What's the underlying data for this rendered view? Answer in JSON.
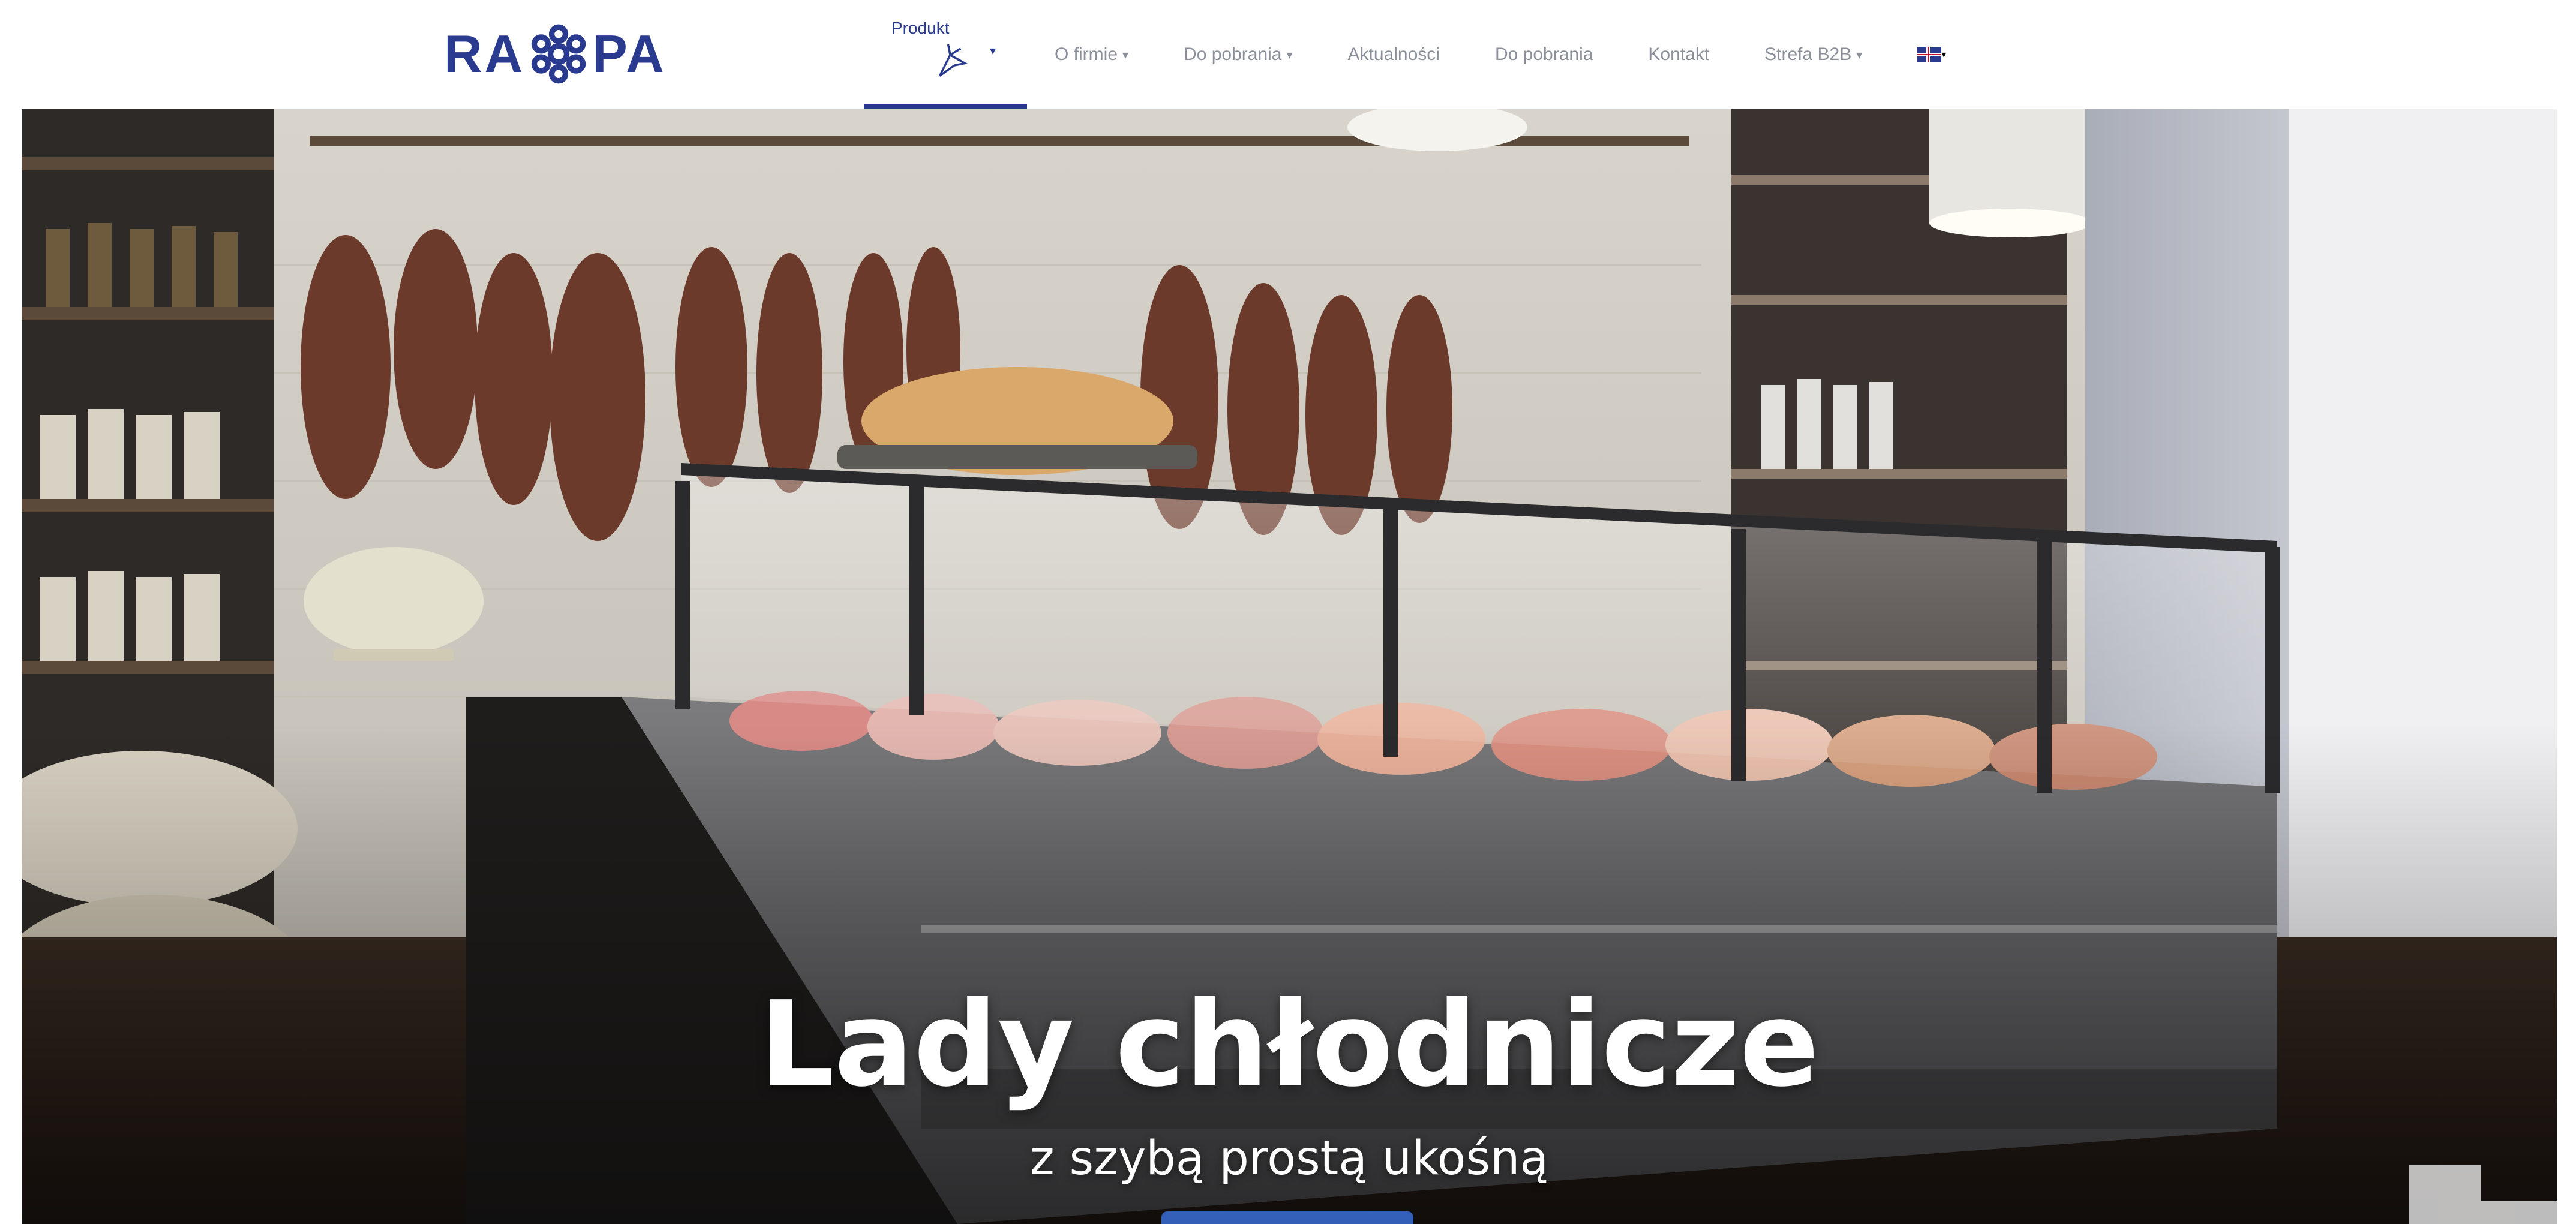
{
  "brand": {
    "logo_text_left": "RA",
    "logo_text_right": "PA",
    "logo_color": "#2a3a8f"
  },
  "nav": {
    "items": [
      {
        "label": "Produkt",
        "active": true,
        "has_dropdown": true,
        "icon": "product-cursor-icon"
      },
      {
        "label": "O firmie",
        "has_dropdown": true
      },
      {
        "label": "Do pobrania"
      },
      {
        "label": "Aktualności"
      },
      {
        "label": "Do pobrania"
      },
      {
        "label": "Kontakt"
      },
      {
        "label": "Strefa B2B",
        "has_dropdown": true
      }
    ],
    "language_icon": "flag-icon",
    "accent_color": "#2a3a8f",
    "text_color": "#8a8f99"
  },
  "hero": {
    "title": "Lady chłodnicze",
    "subtitle": "z szybą prostą ukośną"
  }
}
